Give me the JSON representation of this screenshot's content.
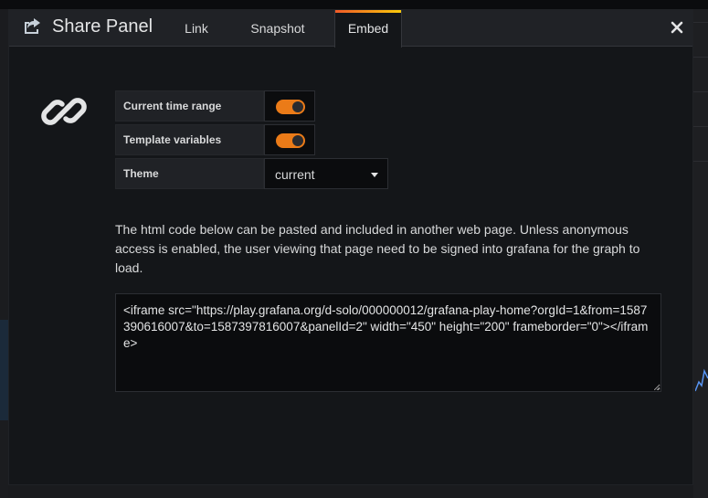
{
  "modal": {
    "title": "Share Panel",
    "tabs": [
      {
        "label": "Link"
      },
      {
        "label": "Snapshot"
      },
      {
        "label": "Embed",
        "active": true
      }
    ]
  },
  "options": {
    "current_time_range": {
      "label": "Current time range",
      "enabled": true
    },
    "template_variables": {
      "label": "Template variables",
      "enabled": true
    },
    "theme": {
      "label": "Theme",
      "value": "current"
    }
  },
  "info_text": "The html code below can be pasted and included in another web page. Unless anonymous access is enabled, the user viewing that page need to be signed into grafana for the graph to load.",
  "embed_code": "<iframe src=\"https://play.grafana.org/d-solo/000000012/grafana-play-home?orgId=1&from=1587390616007&to=1587397816007&panelId=2\" width=\"450\" height=\"200\" frameborder=\"0\"></iframe>",
  "colors": {
    "accent": "#eb7b18",
    "tab_gradient_start": "#f05a28",
    "tab_gradient_end": "#fbca0a",
    "background": "#141619"
  },
  "icons": {
    "header": "share-icon",
    "close": "close-icon",
    "body": "link-icon",
    "select": "caret-down-icon"
  }
}
